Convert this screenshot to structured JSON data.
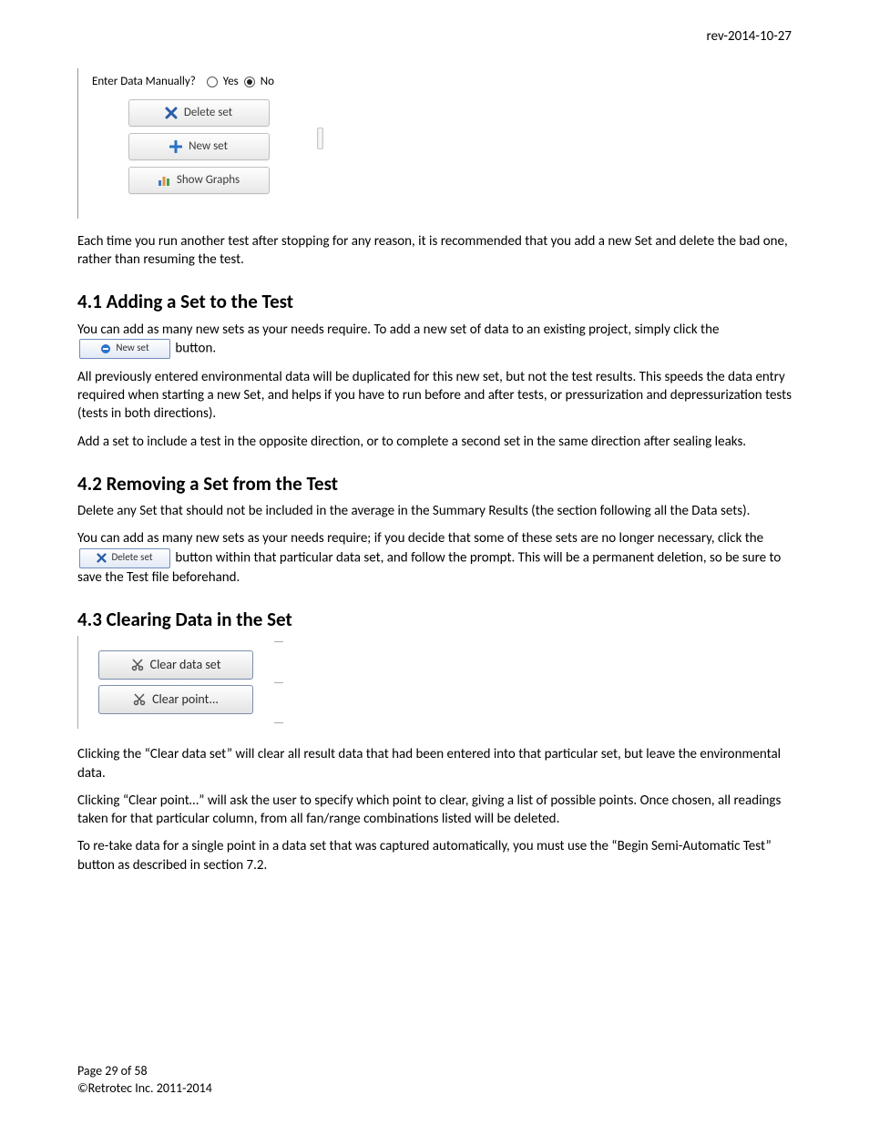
{
  "header": {
    "revision": "rev-2014-10-27"
  },
  "top_ui": {
    "prompt": "Enter Data Manually?",
    "opt_yes": "Yes",
    "opt_no": "No",
    "selected": "No",
    "delete_btn": "Delete set",
    "new_btn": "New set",
    "graphs_btn": "Show Graphs"
  },
  "para_intro": "Each time you run another test after stopping for any reason, it is recommended that you add a new Set and delete the bad one, rather than resuming the test.",
  "sec41": {
    "title": "4.1  Adding a Set to the Test",
    "p1a": "You can add as many new sets as your needs require.  To add a new set of data to an existing project, simply click the ",
    "btn": "New set",
    "p1b": " button.",
    "p2": "All previously entered environmental data will be duplicated for this new set, but not the test results.  This speeds the data entry required when starting a new Set, and helps if you have to run before and after tests, or pressurization and depressurization tests (tests in both directions).",
    "p3": "Add a set to include a test in the opposite direction, or to complete a second set in the same direction after sealing leaks."
  },
  "sec42": {
    "title": "4.2  Removing a Set from the Test",
    "p1": "Delete any Set that should not be included in the average in the Summary Results (the section following all the Data sets).",
    "p2a": "You can add as many new sets as your needs require; if you decide that some of these sets are no longer necessary, click the ",
    "btn": "Delete set",
    "p2b": " button within that particular data set, and follow the prompt.  This will be a permanent deletion, so be sure to save the Test file beforehand."
  },
  "sec43": {
    "title": "4.3  Clearing Data in the Set",
    "btn_clear_set": "Clear data set",
    "btn_clear_point": "Clear point...",
    "p1": "Clicking the “Clear data set” will clear all result data that had been entered into that particular set, but leave the environmental data.",
    "p2": "Clicking “Clear point…”  will ask the user to specify which point to clear, giving a list of possible points.  Once chosen, all readings taken for that particular column, from all fan/range combinations listed will be deleted.",
    "p3": "To re-take data for a single point in a data set that was captured automatically, you must use the “Begin Semi-Automatic Test” button as described in section 7.2."
  },
  "footer": {
    "page": "Page 29 of 58",
    "copyright": "©Retrotec Inc. 2011-2014"
  }
}
